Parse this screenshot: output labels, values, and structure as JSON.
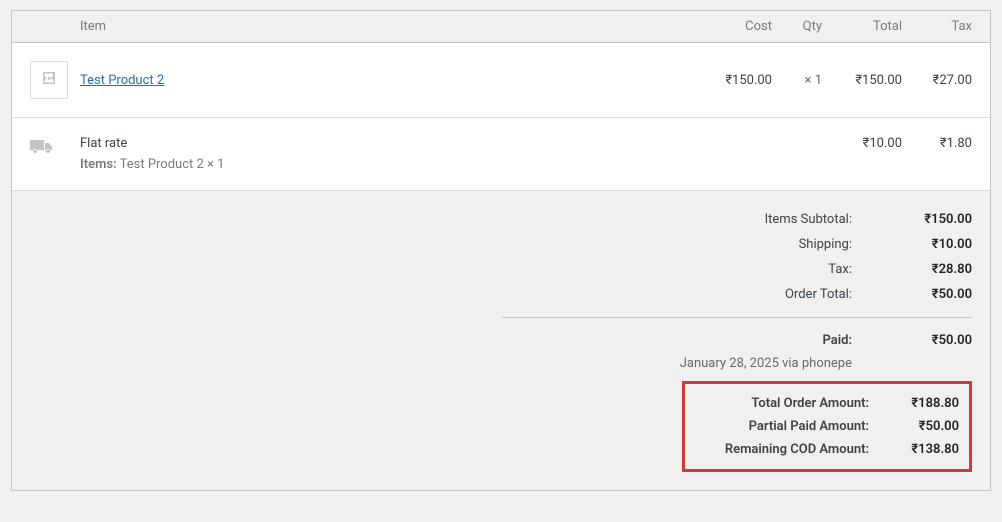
{
  "header": {
    "item": "Item",
    "cost": "Cost",
    "qty": "Qty",
    "total": "Total",
    "tax": "Tax"
  },
  "line_item": {
    "name": "Test Product 2",
    "cost": "₹150.00",
    "qty_prefix": "×",
    "qty": "1",
    "total": "₹150.00",
    "tax": "₹27.00"
  },
  "shipping": {
    "name": "Flat rate",
    "items_label": "Items:",
    "items_value": "Test Product 2 × 1",
    "total": "₹10.00",
    "tax": "₹1.80"
  },
  "totals": {
    "items_subtotal_label": "Items Subtotal:",
    "items_subtotal_value": "₹150.00",
    "shipping_label": "Shipping:",
    "shipping_value": "₹10.00",
    "tax_label": "Tax:",
    "tax_value": "₹28.80",
    "order_total_label": "Order Total:",
    "order_total_value": "₹50.00",
    "paid_label": "Paid:",
    "paid_value": "₹50.00",
    "paid_meta": "January 28, 2025 via phonepe",
    "total_order_amount_label": "Total Order Amount:",
    "total_order_amount_value": "₹188.80",
    "partial_paid_label": "Partial Paid Amount:",
    "partial_paid_value": "₹50.00",
    "remaining_cod_label": "Remaining COD Amount:",
    "remaining_cod_value": "₹138.80"
  }
}
